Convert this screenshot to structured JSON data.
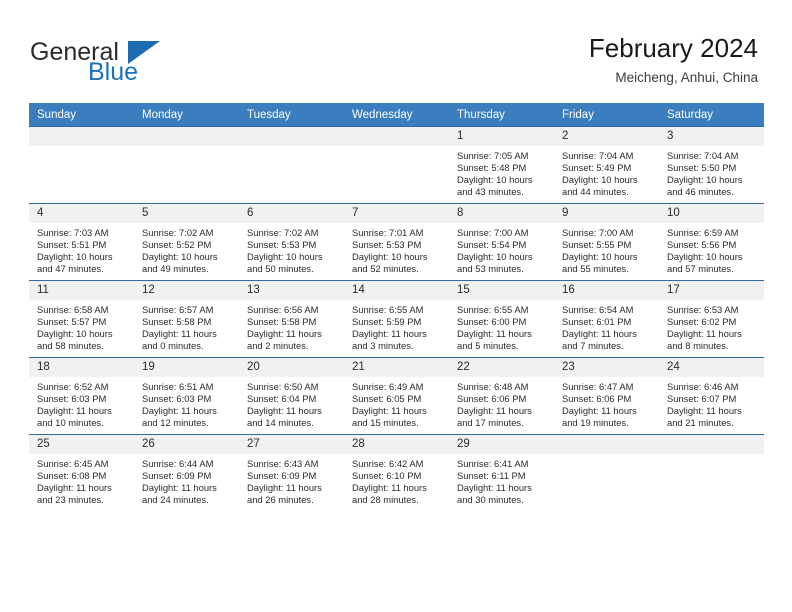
{
  "brand": {
    "name_top": "General",
    "name_bottom": "Blue",
    "color_top": "#2b2b2b",
    "color_bottom": "#1b72b8",
    "triangle_color": "#1b6cb0"
  },
  "header": {
    "title": "February 2024",
    "subtitle": "Meicheng, Anhui, China"
  },
  "theme": {
    "header_row_bg": "#3a7ebf",
    "header_row_text": "#ffffff",
    "cell_border": "#2e6da4",
    "daynum_bg": "#f1f1f1",
    "text": "#2b2b2b"
  },
  "calendar": {
    "weekday_headers": [
      "Sunday",
      "Monday",
      "Tuesday",
      "Wednesday",
      "Thursday",
      "Friday",
      "Saturday"
    ],
    "labels": {
      "sunrise": "Sunrise:",
      "sunset": "Sunset:",
      "daylight": "Daylight:"
    },
    "weeks": [
      [
        {
          "day": "",
          "blank": true
        },
        {
          "day": "",
          "blank": true
        },
        {
          "day": "",
          "blank": true
        },
        {
          "day": "",
          "blank": true
        },
        {
          "day": "1",
          "sunrise": "Sunrise: 7:05 AM",
          "sunset": "Sunset: 5:48 PM",
          "daylight1": "Daylight: 10 hours",
          "daylight2": "and 43 minutes."
        },
        {
          "day": "2",
          "sunrise": "Sunrise: 7:04 AM",
          "sunset": "Sunset: 5:49 PM",
          "daylight1": "Daylight: 10 hours",
          "daylight2": "and 44 minutes."
        },
        {
          "day": "3",
          "sunrise": "Sunrise: 7:04 AM",
          "sunset": "Sunset: 5:50 PM",
          "daylight1": "Daylight: 10 hours",
          "daylight2": "and 46 minutes."
        }
      ],
      [
        {
          "day": "4",
          "sunrise": "Sunrise: 7:03 AM",
          "sunset": "Sunset: 5:51 PM",
          "daylight1": "Daylight: 10 hours",
          "daylight2": "and 47 minutes."
        },
        {
          "day": "5",
          "sunrise": "Sunrise: 7:02 AM",
          "sunset": "Sunset: 5:52 PM",
          "daylight1": "Daylight: 10 hours",
          "daylight2": "and 49 minutes."
        },
        {
          "day": "6",
          "sunrise": "Sunrise: 7:02 AM",
          "sunset": "Sunset: 5:53 PM",
          "daylight1": "Daylight: 10 hours",
          "daylight2": "and 50 minutes."
        },
        {
          "day": "7",
          "sunrise": "Sunrise: 7:01 AM",
          "sunset": "Sunset: 5:53 PM",
          "daylight1": "Daylight: 10 hours",
          "daylight2": "and 52 minutes."
        },
        {
          "day": "8",
          "sunrise": "Sunrise: 7:00 AM",
          "sunset": "Sunset: 5:54 PM",
          "daylight1": "Daylight: 10 hours",
          "daylight2": "and 53 minutes."
        },
        {
          "day": "9",
          "sunrise": "Sunrise: 7:00 AM",
          "sunset": "Sunset: 5:55 PM",
          "daylight1": "Daylight: 10 hours",
          "daylight2": "and 55 minutes."
        },
        {
          "day": "10",
          "sunrise": "Sunrise: 6:59 AM",
          "sunset": "Sunset: 5:56 PM",
          "daylight1": "Daylight: 10 hours",
          "daylight2": "and 57 minutes."
        }
      ],
      [
        {
          "day": "11",
          "sunrise": "Sunrise: 6:58 AM",
          "sunset": "Sunset: 5:57 PM",
          "daylight1": "Daylight: 10 hours",
          "daylight2": "and 58 minutes."
        },
        {
          "day": "12",
          "sunrise": "Sunrise: 6:57 AM",
          "sunset": "Sunset: 5:58 PM",
          "daylight1": "Daylight: 11 hours",
          "daylight2": "and 0 minutes."
        },
        {
          "day": "13",
          "sunrise": "Sunrise: 6:56 AM",
          "sunset": "Sunset: 5:58 PM",
          "daylight1": "Daylight: 11 hours",
          "daylight2": "and 2 minutes."
        },
        {
          "day": "14",
          "sunrise": "Sunrise: 6:55 AM",
          "sunset": "Sunset: 5:59 PM",
          "daylight1": "Daylight: 11 hours",
          "daylight2": "and 3 minutes."
        },
        {
          "day": "15",
          "sunrise": "Sunrise: 6:55 AM",
          "sunset": "Sunset: 6:00 PM",
          "daylight1": "Daylight: 11 hours",
          "daylight2": "and 5 minutes."
        },
        {
          "day": "16",
          "sunrise": "Sunrise: 6:54 AM",
          "sunset": "Sunset: 6:01 PM",
          "daylight1": "Daylight: 11 hours",
          "daylight2": "and 7 minutes."
        },
        {
          "day": "17",
          "sunrise": "Sunrise: 6:53 AM",
          "sunset": "Sunset: 6:02 PM",
          "daylight1": "Daylight: 11 hours",
          "daylight2": "and 8 minutes."
        }
      ],
      [
        {
          "day": "18",
          "sunrise": "Sunrise: 6:52 AM",
          "sunset": "Sunset: 6:03 PM",
          "daylight1": "Daylight: 11 hours",
          "daylight2": "and 10 minutes."
        },
        {
          "day": "19",
          "sunrise": "Sunrise: 6:51 AM",
          "sunset": "Sunset: 6:03 PM",
          "daylight1": "Daylight: 11 hours",
          "daylight2": "and 12 minutes."
        },
        {
          "day": "20",
          "sunrise": "Sunrise: 6:50 AM",
          "sunset": "Sunset: 6:04 PM",
          "daylight1": "Daylight: 11 hours",
          "daylight2": "and 14 minutes."
        },
        {
          "day": "21",
          "sunrise": "Sunrise: 6:49 AM",
          "sunset": "Sunset: 6:05 PM",
          "daylight1": "Daylight: 11 hours",
          "daylight2": "and 15 minutes."
        },
        {
          "day": "22",
          "sunrise": "Sunrise: 6:48 AM",
          "sunset": "Sunset: 6:06 PM",
          "daylight1": "Daylight: 11 hours",
          "daylight2": "and 17 minutes."
        },
        {
          "day": "23",
          "sunrise": "Sunrise: 6:47 AM",
          "sunset": "Sunset: 6:06 PM",
          "daylight1": "Daylight: 11 hours",
          "daylight2": "and 19 minutes."
        },
        {
          "day": "24",
          "sunrise": "Sunrise: 6:46 AM",
          "sunset": "Sunset: 6:07 PM",
          "daylight1": "Daylight: 11 hours",
          "daylight2": "and 21 minutes."
        }
      ],
      [
        {
          "day": "25",
          "sunrise": "Sunrise: 6:45 AM",
          "sunset": "Sunset: 6:08 PM",
          "daylight1": "Daylight: 11 hours",
          "daylight2": "and 23 minutes."
        },
        {
          "day": "26",
          "sunrise": "Sunrise: 6:44 AM",
          "sunset": "Sunset: 6:09 PM",
          "daylight1": "Daylight: 11 hours",
          "daylight2": "and 24 minutes."
        },
        {
          "day": "27",
          "sunrise": "Sunrise: 6:43 AM",
          "sunset": "Sunset: 6:09 PM",
          "daylight1": "Daylight: 11 hours",
          "daylight2": "and 26 minutes."
        },
        {
          "day": "28",
          "sunrise": "Sunrise: 6:42 AM",
          "sunset": "Sunset: 6:10 PM",
          "daylight1": "Daylight: 11 hours",
          "daylight2": "and 28 minutes."
        },
        {
          "day": "29",
          "sunrise": "Sunrise: 6:41 AM",
          "sunset": "Sunset: 6:11 PM",
          "daylight1": "Daylight: 11 hours",
          "daylight2": "and 30 minutes."
        },
        {
          "day": "",
          "blank": true
        },
        {
          "day": "",
          "blank": true
        }
      ]
    ]
  }
}
